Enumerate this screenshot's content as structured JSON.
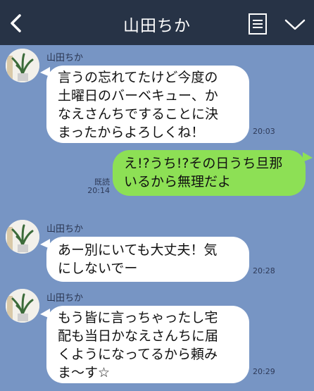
{
  "header": {
    "title": "山田ちか",
    "back_icon": "chevron-left-icon",
    "memo_icon": "note-list-icon",
    "menu_icon": "chevron-down-icon",
    "background": "#273346"
  },
  "chat": {
    "background": "#7795c4",
    "messages": [
      {
        "sender": "山田ちか",
        "direction": "incoming",
        "lines": [
          "言うの忘れてたけど今度の",
          "土曜日のバーベキュー、か",
          "なえさんちですることに決",
          "まったからよろしくね！"
        ],
        "time": "20:03"
      },
      {
        "direction": "outgoing",
        "lines": [
          "え!?うち!?その日うち旦那",
          "いるから無理だよ"
        ],
        "read_label": "既読",
        "time": "20:14"
      },
      {
        "sender": "山田ちか",
        "direction": "incoming",
        "lines": [
          "あー別にいても大丈夫！気",
          "にしないでー"
        ],
        "time": "20:28"
      },
      {
        "sender": "山田ちか",
        "direction": "incoming",
        "lines": [
          "もう皆に言っちゃったし宅",
          "配も当日かなえさんちに届",
          "くようになってるから頼み",
          "ま〜す☆"
        ],
        "time": "20:29"
      }
    ],
    "colors": {
      "incoming_bubble": "#ffffff",
      "outgoing_bubble": "#8de055"
    }
  }
}
